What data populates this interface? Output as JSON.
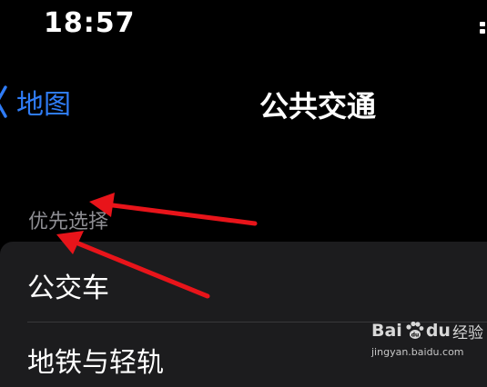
{
  "status_bar": {
    "time": "18:57"
  },
  "nav": {
    "back_label": "地图",
    "title": "公共交通"
  },
  "section": {
    "header": "优先选择",
    "rows": [
      {
        "label": "公交车"
      },
      {
        "label": "地铁与轻轨"
      }
    ]
  },
  "watermark": {
    "brand_prefix": "Bai",
    "brand_suffix": "du",
    "word": "经验",
    "url": "jingyan.baidu.com"
  },
  "colors": {
    "background": "#000000",
    "accent": "#2f7cf6",
    "secondary_text": "#8d8d92",
    "card": "#1c1c1e",
    "annotation_arrow": "#e8141a"
  },
  "icons": {
    "back": "chevron-left-icon",
    "brand": "baidu-paw-icon",
    "annotation": "red-arrow-icon"
  }
}
